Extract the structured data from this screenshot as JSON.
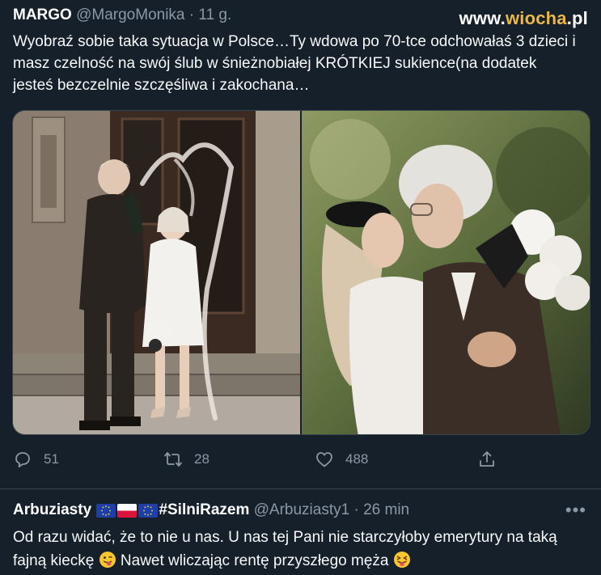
{
  "tweet": {
    "author_name": "MARGO",
    "author_handle": "@MargoMonika",
    "separator": "·",
    "time": "11 g.",
    "text": "Wyobraź sobie taka sytuacja w Polsce…Ty wdowa po 70-tce odchowałaś 3 dzieci i masz czelność na swój ślub w śnieżnobiałej KRÓTKIEJ sukience(na dodatek jesteś bezczelnie szczęśliwa i zakochana…",
    "media": [
      {
        "icon": "photo-wedding-champagne"
      },
      {
        "icon": "photo-wedding-embrace"
      }
    ],
    "actions": {
      "reply_count": "51",
      "retweet_count": "28",
      "like_count": "488"
    }
  },
  "watermark": {
    "prefix": "www.",
    "highlight": "wiocha",
    "suffix": ".pl"
  },
  "reply": {
    "author_name": "Arbuziasty",
    "flags": [
      "eu-flag",
      "poland-flag",
      "eu-flag"
    ],
    "hashtag": "#SilniRazem",
    "author_handle": "@Arbuziasty1",
    "separator": "·",
    "time": "26 min",
    "more": "•••",
    "text_part1": "Od razu widać, że to nie u nas. U nas tej Pani nie starczyłoby emerytury na taką fajną kieckę",
    "text_part2": "Nawet wliczając rentę przyszłego męża",
    "emojis": [
      "winking-face-with-tongue",
      "squinting-face-with-tongue"
    ]
  },
  "colors": {
    "background": "#15202b",
    "secondary_text": "#8b98a5",
    "border": "#38444d",
    "watermark_accent": "#e8b84a"
  }
}
